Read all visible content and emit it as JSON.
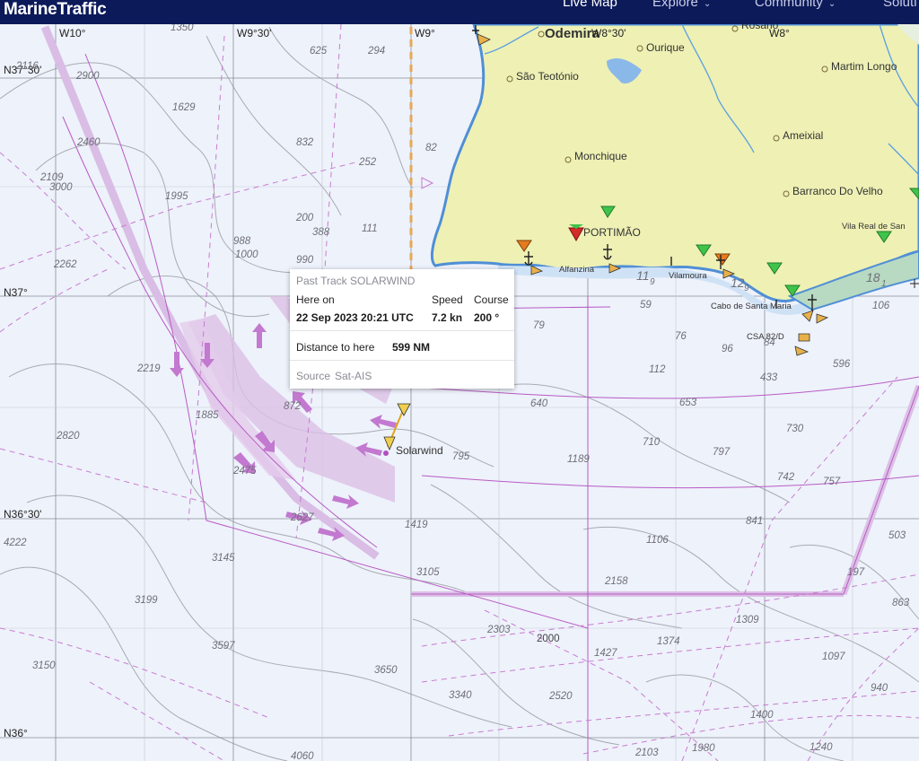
{
  "app": {
    "brand": "MarineTraffic",
    "nav": [
      "Live Map",
      "Explore",
      "Community",
      "Soluti"
    ]
  },
  "grid": {
    "longitudes": [
      "W10°",
      "W9°30'",
      "W9°",
      "W8°30'",
      "W8°"
    ],
    "latitudes": [
      "N37°30'",
      "N37°",
      "N36°30'",
      "N36°"
    ]
  },
  "places": [
    "Odemira",
    "Ourique",
    "Rosário",
    "São Teotónio",
    "Martim Longo",
    "Ameixial",
    "Monchique",
    "Barranco Do Velho",
    "PORTIMÃO",
    "Vila Real de San",
    "Alfanzina",
    "Vilamoura",
    "Cabo de Santa Maria",
    "CSA 82/D",
    "Solarwind"
  ],
  "depths": [
    "2116",
    "2900",
    "1629",
    "2460",
    "2109",
    "3000",
    "1995",
    "2262",
    "625",
    "294",
    "832",
    "252",
    "200",
    "388",
    "111",
    "988",
    "1000",
    "990",
    "1350",
    "82",
    "2219",
    "1885",
    "872",
    "2820",
    "2475",
    "2627",
    "795",
    "1189",
    "710",
    "730",
    "797",
    "742",
    "757",
    "640",
    "653",
    "112",
    "433",
    "596",
    "79",
    "76",
    "96",
    "84",
    "59",
    "106",
    "841",
    "1106",
    "1419",
    "3105",
    "3145",
    "2158",
    "503",
    "197",
    "863",
    "4222",
    "3199",
    "3597",
    "3150",
    "3650",
    "2303",
    "2000",
    "1427",
    "1374",
    "1309",
    "1097",
    "940",
    "3340",
    "2520",
    "1400",
    "4060",
    "2103",
    "1980",
    "1240",
    "11",
    "9",
    "12",
    "9",
    "18",
    "1"
  ],
  "popup": {
    "title": "Past Track SOLARWIND",
    "here_on_label": "Here on",
    "here_on_value": "22 Sep 2023 20:21 UTC",
    "speed_label": "Speed",
    "speed_value": "7.2 kn",
    "course_label": "Course",
    "course_value": "200 °",
    "distance_label": "Distance to here",
    "distance_value": "599 NM",
    "source_label": "Source",
    "source_value": "Sat-AIS"
  },
  "colors": {
    "navbar": "#0c1a5a",
    "sea": "#eef2fb",
    "land": "#eef0b4",
    "coast": "#4f8fd6",
    "tss": "#c9a0d9",
    "route": "#b85bc4",
    "track": "#e0a51c"
  }
}
